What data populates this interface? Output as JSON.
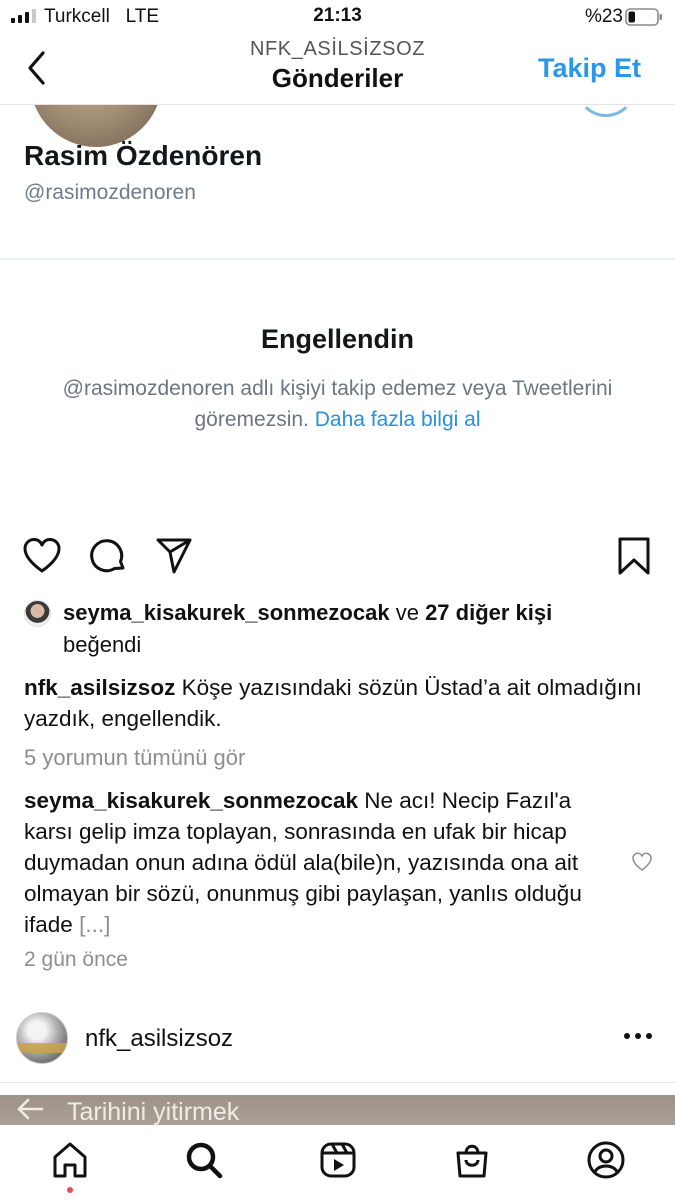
{
  "status_bar": {
    "carrier": "Turkcell   LTE",
    "time": "21:13",
    "battery": "%23"
  },
  "header": {
    "account": "NFK_ASİLSİZSOZ",
    "title": "Gönderiler",
    "follow_label": "Takip Et"
  },
  "tweet_screenshot": {
    "name": "Rasim Özdenören",
    "handle": "@rasimozdenoren",
    "blocked_title": "Engellendin",
    "blocked_text": "@rasimozdenoren adlı kişiyi takip edemez veya Tweetlerini göremezsin.",
    "learn_more": "Daha fazla bilgi al"
  },
  "likes": {
    "user": "seyma_kisakurek_sonmezocak",
    "and": "ve",
    "others": "27 diğer kişi",
    "liked": "beğendi"
  },
  "caption": {
    "user": "nfk_asilsizsoz",
    "text": "Köşe yazısındaki sözün Üstad’a ait olmadığını yazdık, engellendik."
  },
  "view_comments": "5 yorumun tümünü gör",
  "comment": {
    "user": "seyma_kisakurek_sonmezocak",
    "text": "Ne acı! Necip Fazıl'a karsı gelip imza toplayan, sonrasında en ufak bir hicap duymadan onun adına ödül ala(bile)n, yazısında ona ait olmayan bir sözü, onunmuş gibi paylaşan, yanlıs olduğu ifade",
    "more": "[...]"
  },
  "time_ago": "2 gün önce",
  "next_post": {
    "username": "nfk_asilsizsoz",
    "preview_text": "Tarihini yitirmek"
  },
  "icons": {
    "actions": [
      "heart-icon",
      "comment-icon",
      "share-icon",
      "bookmark-icon"
    ],
    "nav": [
      "home-icon",
      "search-icon",
      "reels-icon",
      "shop-icon",
      "profile-icon"
    ]
  },
  "colors": {
    "accent": "#2a97e8",
    "twitter_link": "#2a90d9",
    "notification_dot": "#ed4956",
    "muted": "#8e8e8e"
  }
}
